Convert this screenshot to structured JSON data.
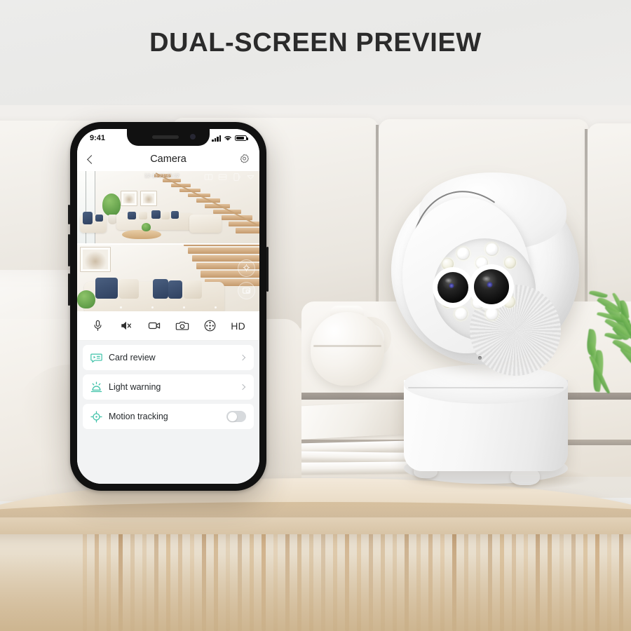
{
  "page": {
    "title": "DUAL-SCREEN PREVIEW",
    "accent_teal": "#3ec2a8",
    "title_color": "#2b2b2b",
    "phone_bezel_color": "#111111"
  },
  "phone": {
    "status_bar": {
      "time": "9:41",
      "signal_icon": "cellular-signal-icon",
      "wifi_icon": "wifi-icon",
      "battery_icon": "battery-icon"
    },
    "nav_bar": {
      "back_icon": "chevron-left-icon",
      "title": "Camera",
      "settings_icon": "gear-icon"
    },
    "video_feed": {
      "timestamp": "12-13 21:45:12",
      "split_view": true,
      "top_right_icons": [
        "screen-split-icon",
        "screen-layout-icon",
        "rotate-screen-icon",
        "privacy-mask-icon"
      ],
      "side_buttons": [
        "light-bulb-icon",
        "picture-in-picture-icon"
      ]
    },
    "control_bar": [
      {
        "name": "microphone-icon",
        "label": ""
      },
      {
        "name": "speaker-muted-icon",
        "label": ""
      },
      {
        "name": "video-record-icon",
        "label": ""
      },
      {
        "name": "snapshot-camera-icon",
        "label": ""
      },
      {
        "name": "direction-pad-icon",
        "label": ""
      },
      {
        "name": "quality-hd-label",
        "label": "HD"
      }
    ],
    "list_rows": [
      {
        "icon": "card-review-icon",
        "label": "Card review",
        "control": "chevron"
      },
      {
        "icon": "light-warning-icon",
        "label": "Light warning",
        "control": "chevron"
      },
      {
        "icon": "motion-tracking-icon",
        "label": "Motion tracking",
        "control": "toggle",
        "toggle_on": false
      }
    ]
  },
  "device": {
    "name": "dual-lens-ptz-camera",
    "lens_count": 2,
    "led_count": 10,
    "body_color": "#ffffff"
  }
}
